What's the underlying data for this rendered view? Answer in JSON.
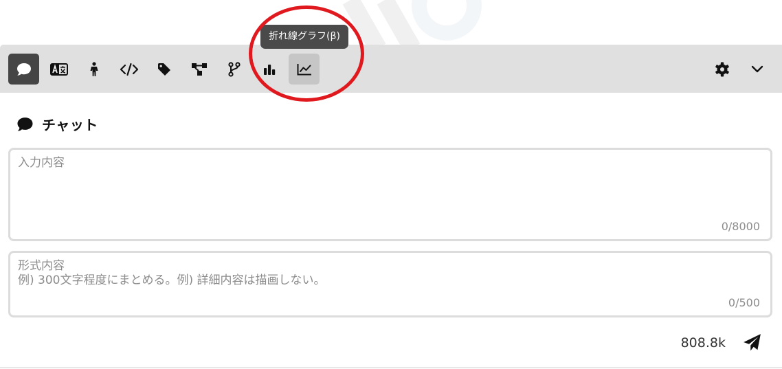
{
  "tooltip": {
    "text": "折れ線グラフ(β)"
  },
  "toolbar": {
    "buttons": [
      {
        "name": "chat",
        "icon": "comment-icon",
        "active": true
      },
      {
        "name": "translate",
        "icon": "language-icon"
      },
      {
        "name": "person",
        "icon": "person-icon"
      },
      {
        "name": "code",
        "icon": "code-icon"
      },
      {
        "name": "tag",
        "icon": "tag-icon"
      },
      {
        "name": "diagram",
        "icon": "diagram-icon"
      },
      {
        "name": "branch",
        "icon": "branch-icon"
      },
      {
        "name": "bar-chart",
        "icon": "bar-chart-icon"
      },
      {
        "name": "line-chart",
        "icon": "line-chart-icon",
        "hovered": true
      }
    ],
    "settings_icon": "gear-icon",
    "collapse_icon": "chevron-down-icon"
  },
  "heading": {
    "icon": "comment-icon",
    "title": "チャット"
  },
  "input": {
    "placeholder": "入力内容",
    "counter": "0/8000"
  },
  "format": {
    "placeholder": "形式内容\n例) 300文字程度にまとめる。例) 詳細内容は描画しない。",
    "counter": "0/500"
  },
  "footer": {
    "token_count": "808.8k",
    "send_icon": "paper-plane-icon"
  },
  "colors": {
    "toolbar_bg": "#e0e0e0",
    "active_bg": "#454545",
    "hover_bg": "#c6c6c6",
    "annotation": "#e0191f"
  }
}
